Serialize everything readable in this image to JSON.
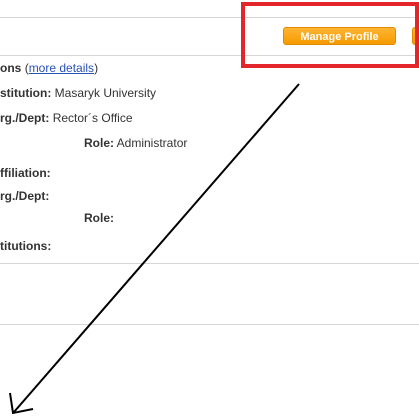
{
  "header": {
    "manage_profile_label": "Manage Profile"
  },
  "section": {
    "title_fragment": "ons",
    "more_details_open": "(",
    "more_details_link": "more details",
    "more_details_close": ")"
  },
  "current_affiliation": {
    "institution_label": "stitution:",
    "institution_value": "Masaryk University",
    "org_label": "rg./Dept:",
    "org_value": "Rector´s Office",
    "role_label": "Role:",
    "role_value": "Administrator"
  },
  "other_affiliation": {
    "affiliation_label": "ffiliation:",
    "org_label": "rg./Dept:",
    "role_label": "Role:"
  },
  "institutions": {
    "label": "titutions:"
  },
  "colors": {
    "button": "#f59a00",
    "highlight": "#e3262b",
    "link": "#2a52b5"
  }
}
